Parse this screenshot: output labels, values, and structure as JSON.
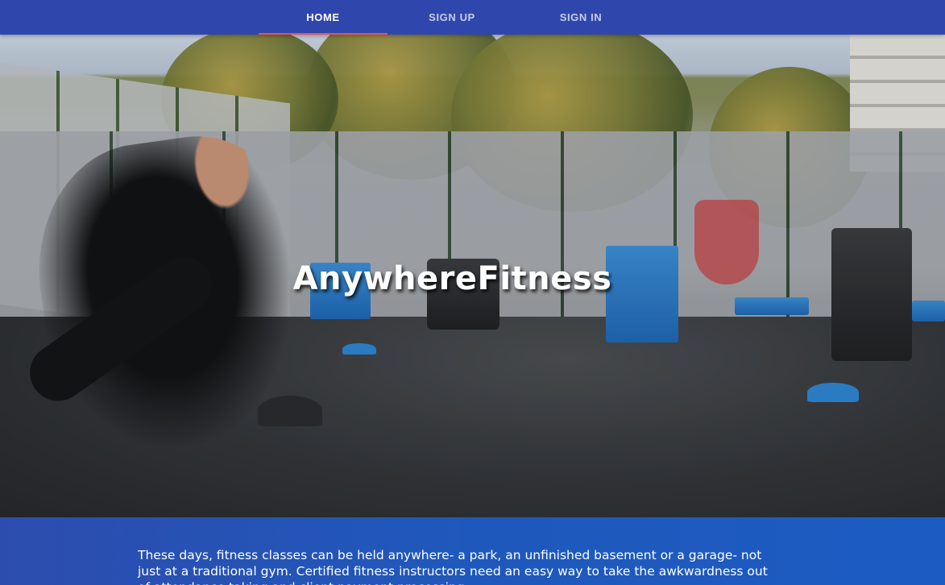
{
  "nav": {
    "tabs": [
      {
        "label": "HOME",
        "active": true
      },
      {
        "label": "SIGN UP",
        "active": false
      },
      {
        "label": "SIGN IN",
        "active": false
      }
    ],
    "indicator_color": "#e8505b",
    "background": "#2f47ad"
  },
  "hero": {
    "title": "AnywhereFitness",
    "image": "outdoor-fitness-class-photo"
  },
  "intro": {
    "text": "These days, fitness classes can be held anywhere- a park, an unfinished basement or a garage- not just at a traditional gym. Certified fitness instructors need an easy way to take the awkwardness out of attendance taking and client payment processing."
  }
}
